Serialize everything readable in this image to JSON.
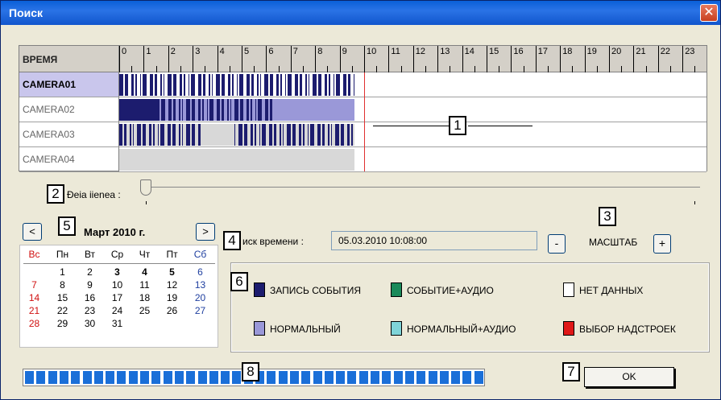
{
  "window": {
    "title": "Поиск",
    "close_label": "✕"
  },
  "timeline": {
    "time_header": "ВРЕМЯ",
    "hours": [
      "0",
      "1",
      "2",
      "3",
      "4",
      "5",
      "6",
      "7",
      "8",
      "9",
      "10",
      "11",
      "12",
      "13",
      "14",
      "15",
      "16",
      "17",
      "18",
      "19",
      "20",
      "21",
      "22",
      "23"
    ],
    "cameras": [
      {
        "name": "CAMERA01",
        "selected": true
      },
      {
        "name": "CAMERA02",
        "selected": false
      },
      {
        "name": "CAMERA03",
        "selected": false
      },
      {
        "name": "CAMERA04",
        "selected": false
      }
    ],
    "cursor_hour": 10.0
  },
  "speed": {
    "label": "Ðeia iienea :"
  },
  "calendar": {
    "month_title": "Март 2010 г.",
    "prev_label": "<",
    "next_label": ">",
    "weekdays": [
      "Вс",
      "Пн",
      "Вт",
      "Ср",
      "Чт",
      "Пт",
      "Сб"
    ],
    "weeks": [
      [
        "",
        "1",
        "2",
        "3",
        "4",
        "5",
        "6"
      ],
      [
        "7",
        "8",
        "9",
        "10",
        "11",
        "12",
        "13"
      ],
      [
        "14",
        "15",
        "16",
        "17",
        "18",
        "19",
        "20"
      ],
      [
        "21",
        "22",
        "23",
        "24",
        "25",
        "26",
        "27"
      ],
      [
        "28",
        "29",
        "30",
        "31",
        "",
        "",
        ""
      ]
    ],
    "bold_days": [
      "3",
      "4",
      "5"
    ]
  },
  "search": {
    "label": "иск времени :",
    "value": "05.03.2010 10:08:00",
    "minus_label": "-",
    "scale_label": "МАСШТАБ",
    "plus_label": "+"
  },
  "legend": [
    {
      "label": "ЗАПИСЬ СОБЫТИЯ",
      "color": "#1c1c6e"
    },
    {
      "label": "СОБЫТИЕ+АУДИО",
      "color": "#1a8a5a"
    },
    {
      "label": "НЕТ ДАННЫХ",
      "color": "#ffffff"
    },
    {
      "label": "НОРМАЛЬНЫЙ",
      "color": "#9a98d8"
    },
    {
      "label": "НОРМАЛЬНЫЙ+АУДИО",
      "color": "#7fd4d8"
    },
    {
      "label": "ВЫБОР НАДСТРОЕК",
      "color": "#e01818"
    }
  ],
  "progress": {
    "segments": 40,
    "fraction": 1.0
  },
  "ok_label": "OK",
  "callouts": [
    "1",
    "2",
    "3",
    "4",
    "5",
    "6",
    "7",
    "8"
  ],
  "colors": {
    "event": "#1c1c6e",
    "normal": "#9a98d8",
    "nodata_recorded": "#d8d8d8",
    "cursor": "#e03030",
    "progress": "#1a6fd8"
  }
}
